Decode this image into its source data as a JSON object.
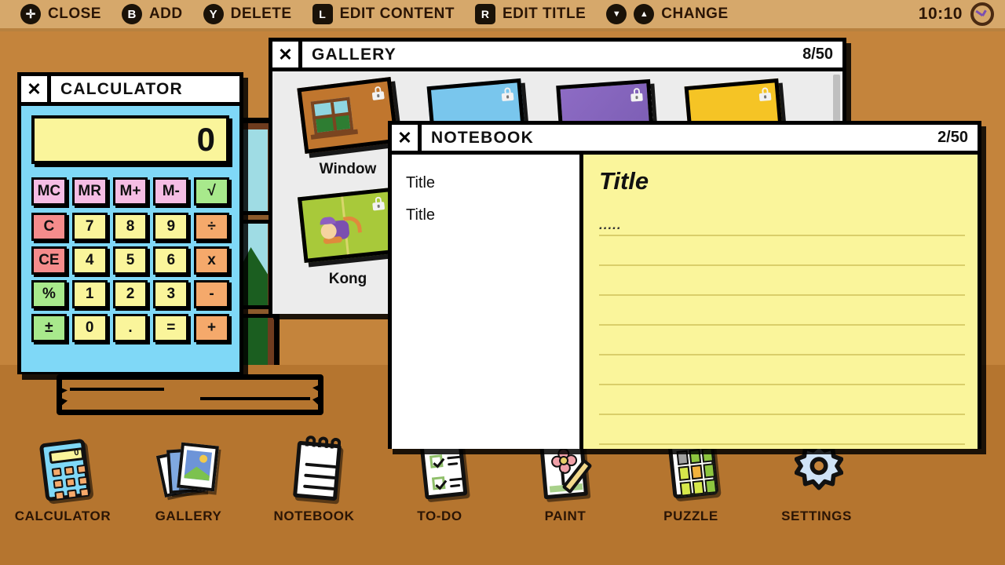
{
  "topbar": {
    "actions": [
      {
        "icon": "plus-button-icon",
        "glyph": "✛",
        "label": "CLOSE"
      },
      {
        "icon": "b-button-icon",
        "glyph": "B",
        "label": "ADD"
      },
      {
        "icon": "y-button-icon",
        "glyph": "Y",
        "label": "DELETE"
      },
      {
        "icon": "l-button-icon",
        "glyph": "L",
        "label": "EDIT CONTENT"
      },
      {
        "icon": "r-button-icon",
        "glyph": "R",
        "label": "EDIT TITLE"
      },
      {
        "icon": "dpad-down-icon",
        "glyph": "▼",
        "label": ""
      },
      {
        "icon": "dpad-up-icon",
        "glyph": "▲",
        "label": "CHANGE"
      }
    ],
    "time": "10:10",
    "clock_icon": "clock-icon"
  },
  "calculator": {
    "title": "CALCULATOR",
    "close_icon": "close-icon",
    "display": "0",
    "memory_keys": [
      {
        "label": "MC",
        "style": "k-mem"
      },
      {
        "label": "MR",
        "style": "k-mem"
      },
      {
        "label": "M+",
        "style": "k-mem"
      },
      {
        "label": "M-",
        "style": "k-mem"
      },
      {
        "label": "√",
        "style": "k-sqrt"
      }
    ],
    "keys": [
      {
        "label": "C",
        "style": "k-clr"
      },
      {
        "label": "7",
        "style": "k-num"
      },
      {
        "label": "8",
        "style": "k-num"
      },
      {
        "label": "9",
        "style": "k-num"
      },
      {
        "label": "÷",
        "style": "k-op"
      },
      {
        "label": "CE",
        "style": "k-clr"
      },
      {
        "label": "4",
        "style": "k-num"
      },
      {
        "label": "5",
        "style": "k-num"
      },
      {
        "label": "6",
        "style": "k-num"
      },
      {
        "label": "x",
        "style": "k-op"
      },
      {
        "label": "%",
        "style": "k-fn"
      },
      {
        "label": "1",
        "style": "k-num"
      },
      {
        "label": "2",
        "style": "k-num"
      },
      {
        "label": "3",
        "style": "k-num"
      },
      {
        "label": "-",
        "style": "k-op"
      },
      {
        "label": "±",
        "style": "k-fn"
      },
      {
        "label": "0",
        "style": "k-num"
      },
      {
        "label": ".",
        "style": "k-num"
      },
      {
        "label": "=",
        "style": "k-num"
      },
      {
        "label": "+",
        "style": "k-op"
      }
    ]
  },
  "gallery": {
    "title": "GALLERY",
    "close_icon": "close-icon",
    "count": "8/50",
    "items": [
      {
        "label": "Window",
        "art": "art-window",
        "tilt": "t1",
        "locked": true,
        "lock_icon": "lock-icon"
      },
      {
        "label": "",
        "art": "art-blue",
        "tilt": "t2",
        "locked": true,
        "lock_icon": "lock-icon"
      },
      {
        "label": "",
        "art": "art-purple",
        "tilt": "t3",
        "locked": true,
        "lock_icon": "lock-icon"
      },
      {
        "label": "",
        "art": "art-yellow",
        "tilt": "t4",
        "locked": true,
        "lock_icon": "lock-icon"
      }
    ],
    "second_row": [
      {
        "label": "Kong",
        "art": "art-green",
        "tilt": "t5",
        "locked": true,
        "lock_icon": "lock-icon"
      }
    ]
  },
  "notebook": {
    "title": "NOTEBOOK",
    "close_icon": "close-icon",
    "count": "2/50",
    "entries": [
      {
        "label": "Title"
      },
      {
        "label": "Title"
      }
    ],
    "page": {
      "title": "Title",
      "body_first_line": ".....",
      "blank_lines": 8
    }
  },
  "dock": {
    "items": [
      {
        "label": "CALCULATOR",
        "icon": "calculator-icon"
      },
      {
        "label": "GALLERY",
        "icon": "gallery-icon"
      },
      {
        "label": "NOTEBOOK",
        "icon": "notebook-icon"
      },
      {
        "label": "TO-DO",
        "icon": "todo-icon"
      },
      {
        "label": "PAINT",
        "icon": "paint-icon"
      },
      {
        "label": "PUZZLE",
        "icon": "puzzle-icon"
      },
      {
        "label": "SETTINGS",
        "icon": "gear-icon"
      }
    ]
  },
  "theme": {
    "background": "#C4843C",
    "floor": "#B5752F",
    "topbar": "#D6A86B",
    "calculator_body": "#7FD8F7",
    "paper_yellow": "#FAF59B",
    "outline": "#000000"
  }
}
